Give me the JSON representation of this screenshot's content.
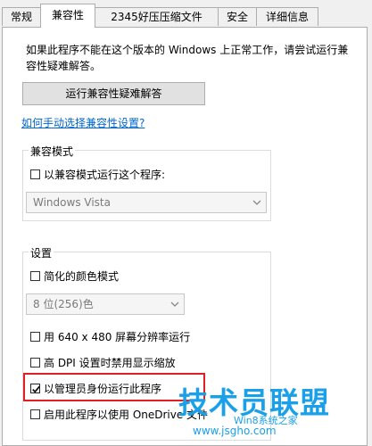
{
  "tabs": [
    {
      "label": "常规",
      "active": false
    },
    {
      "label": "兼容性",
      "active": true
    },
    {
      "label": "2345好压压缩文件",
      "active": false
    },
    {
      "label": "安全",
      "active": false
    },
    {
      "label": "详细信息",
      "active": false
    }
  ],
  "intro_text": "如果此程序不能在这个版本的 Windows 上正常工作，请尝试运行兼容性疑难解答。",
  "troubleshoot_button": "运行兼容性疑难解答",
  "manual_link": "如何手动选择兼容性设置?",
  "compat_group": {
    "title": "兼容模式",
    "checkbox_label": "以兼容模式运行这个程序:",
    "checked": false,
    "select_value": "Windows Vista"
  },
  "settings_group": {
    "title": "设置",
    "reduced_color": {
      "label": "简化的颜色模式",
      "checked": false
    },
    "color_select_value": "8 位(256)色",
    "res_640": {
      "label": "用 640 x 480 屏幕分辨率运行",
      "checked": false
    },
    "high_dpi": {
      "label": "高 DPI 设置时禁用显示缩放",
      "checked": false
    },
    "run_as_admin": {
      "label": "以管理员身份运行此程序",
      "checked": true
    },
    "onedrive": {
      "label": "启用此程序以使用 OneDrive 文件",
      "checked": false
    }
  },
  "watermark": {
    "title": "技术员联盟",
    "subtitle": "Win8系统之家",
    "url": "www.jsgho.com"
  },
  "colors": {
    "accent_link": "#0066cc",
    "highlight": "#e02020",
    "watermark": "#1aa0e8"
  }
}
